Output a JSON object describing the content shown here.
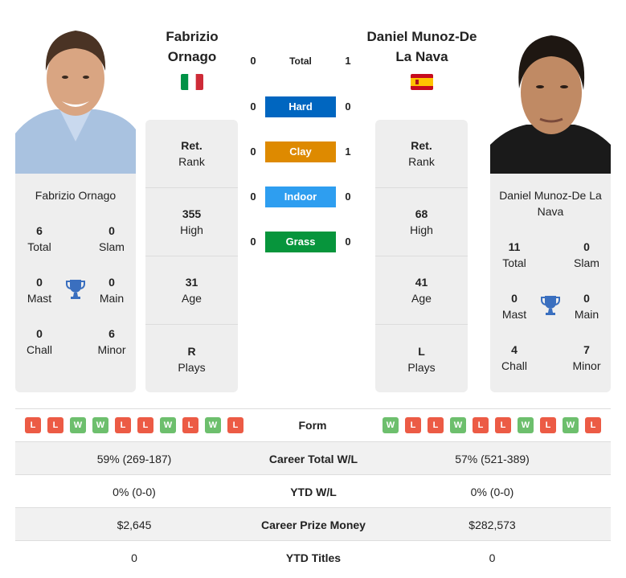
{
  "players": {
    "left": {
      "name": "Fabrizio Ornago",
      "name_line1": "Fabrizio",
      "name_line2": "Ornago",
      "country": "Italy",
      "flag_colors": [
        "#009246",
        "#ffffff",
        "#ce2b37"
      ],
      "titles": {
        "total": {
          "value": "6",
          "label": "Total"
        },
        "slam": {
          "value": "0",
          "label": "Slam"
        },
        "mast": {
          "value": "0",
          "label": "Mast"
        },
        "main": {
          "value": "0",
          "label": "Main"
        },
        "chall": {
          "value": "0",
          "label": "Chall"
        },
        "minor": {
          "value": "6",
          "label": "Minor"
        }
      },
      "rank": {
        "value": "Ret.",
        "label": "Rank"
      },
      "high": {
        "value": "355",
        "label": "High"
      },
      "age": {
        "value": "31",
        "label": "Age"
      },
      "plays": {
        "value": "R",
        "label": "Plays"
      }
    },
    "right": {
      "name": "Daniel Munoz-De La Nava",
      "name_line1": "Daniel Munoz-De",
      "name_line2": "La Nava",
      "country": "Spain",
      "flag_colors": [
        "#c60b1e",
        "#ffc400",
        "#c60b1e"
      ],
      "titles": {
        "total": {
          "value": "11",
          "label": "Total"
        },
        "slam": {
          "value": "0",
          "label": "Slam"
        },
        "mast": {
          "value": "0",
          "label": "Mast"
        },
        "main": {
          "value": "0",
          "label": "Main"
        },
        "chall": {
          "value": "4",
          "label": "Chall"
        },
        "minor": {
          "value": "7",
          "label": "Minor"
        }
      },
      "rank": {
        "value": "Ret.",
        "label": "Rank"
      },
      "high": {
        "value": "68",
        "label": "High"
      },
      "age": {
        "value": "41",
        "label": "Age"
      },
      "plays": {
        "value": "L",
        "label": "Plays"
      }
    }
  },
  "h2h": [
    {
      "label": "Total",
      "left": "0",
      "right": "1",
      "color": null
    },
    {
      "label": "Hard",
      "left": "0",
      "right": "0",
      "color": "#0066c0"
    },
    {
      "label": "Clay",
      "left": "0",
      "right": "1",
      "color": "#de8a00"
    },
    {
      "label": "Indoor",
      "left": "0",
      "right": "0",
      "color": "#2e9ef0"
    },
    {
      "label": "Grass",
      "left": "0",
      "right": "0",
      "color": "#07953c"
    }
  ],
  "form": {
    "label": "Form",
    "left": [
      "L",
      "L",
      "W",
      "W",
      "L",
      "L",
      "W",
      "L",
      "W",
      "L"
    ],
    "right": [
      "W",
      "L",
      "L",
      "W",
      "L",
      "L",
      "W",
      "L",
      "W",
      "L"
    ]
  },
  "stats": [
    {
      "label": "Career Total W/L",
      "left": "59% (269-187)",
      "right": "57% (521-389)"
    },
    {
      "label": "YTD W/L",
      "left": "0% (0-0)",
      "right": "0% (0-0)"
    },
    {
      "label": "Career Prize Money",
      "left": "$2,645",
      "right": "$282,573"
    },
    {
      "label": "YTD Titles",
      "left": "0",
      "right": "0"
    }
  ],
  "colors": {
    "win": "#6dbf6d",
    "loss": "#ec5b45",
    "trophy": "#3a6fbf",
    "card_bg": "#eeeeee"
  }
}
